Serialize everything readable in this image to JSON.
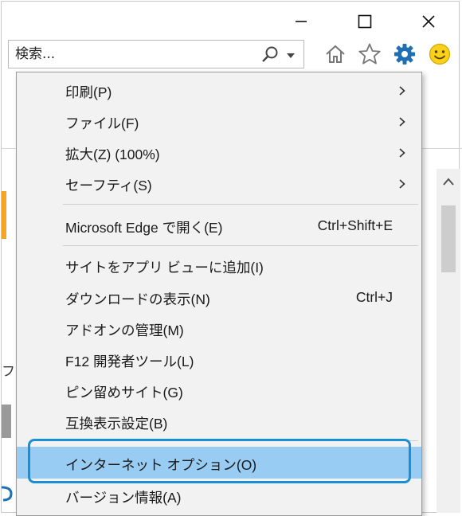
{
  "window": {
    "minimize": "minimize",
    "maximize": "maximize",
    "close": "close"
  },
  "search": {
    "placeholder": "検索..."
  },
  "toolbar": {
    "icons": [
      "home-icon",
      "favorites-star-icon",
      "settings-gear-icon",
      "feedback-smiley-icon"
    ],
    "accent": "#1f6fb5"
  },
  "page_fragments": {
    "fu": "フ"
  },
  "menu": {
    "items": [
      {
        "label": "印刷(P)",
        "submenu": true
      },
      {
        "label": "ファイル(F)",
        "submenu": true
      },
      {
        "label": "拡大(Z) (100%)",
        "submenu": true
      },
      {
        "label": "セーフティ(S)",
        "submenu": true
      },
      {
        "label": "Microsoft Edge で開く(E)",
        "shortcut": "Ctrl+Shift+E"
      },
      {
        "label": "サイトをアプリ ビューに追加(I)"
      },
      {
        "label": "ダウンロードの表示(N)",
        "shortcut": "Ctrl+J"
      },
      {
        "label": "アドオンの管理(M)"
      },
      {
        "label": "F12 開発者ツール(L)"
      },
      {
        "label": "ピン留めサイト(G)"
      },
      {
        "label": "互換表示設定(B)"
      },
      {
        "label": "インターネット オプション(O)",
        "highlighted": true
      },
      {
        "label": "バージョン情報(A)"
      }
    ],
    "highlight_color": "#99ccf3",
    "focus_ring_color": "#1a8fd3"
  }
}
